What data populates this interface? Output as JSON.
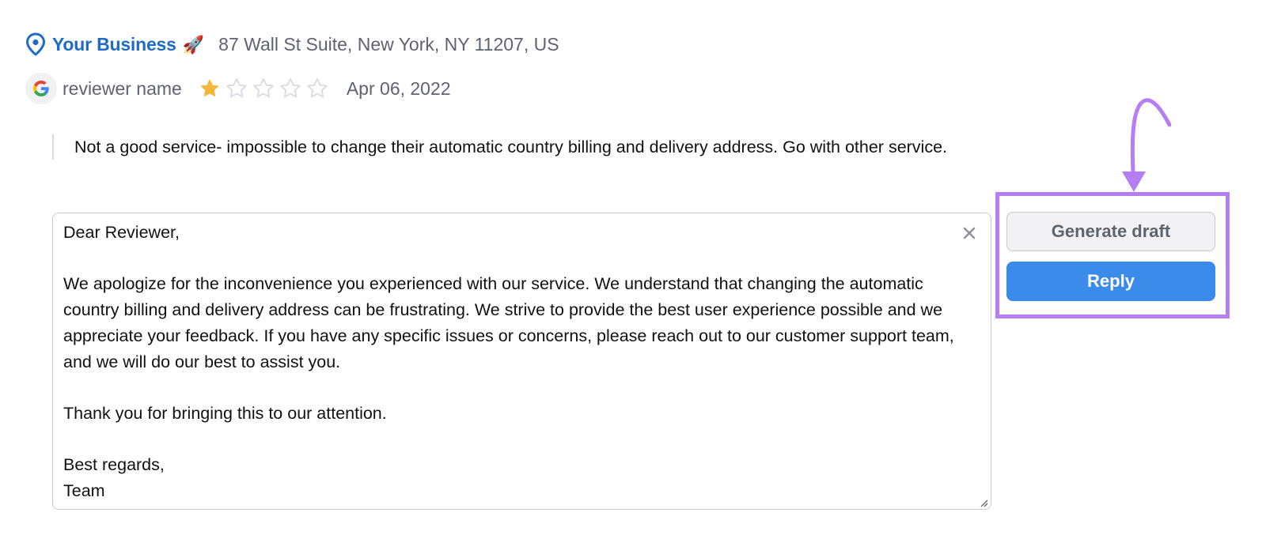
{
  "business": {
    "name": "Your Business",
    "emoji": "🚀",
    "address": "87 Wall St Suite, New York, NY 11207, US"
  },
  "review": {
    "source_icon": "google-icon",
    "reviewer_name": "reviewer name",
    "rating": 1,
    "rating_max": 5,
    "date": "Apr 06, 2022",
    "text": "Not a good service- impossible to change their automatic country billing and delivery address. Go with other service."
  },
  "reply": {
    "value": "Dear Reviewer,\n\nWe apologize for the inconvenience you experienced with our service. We understand that changing the automatic country billing and delivery address can be frustrating. We strive to provide the best user experience possible and we appreciate your feedback. If you have any specific issues or concerns, please reach out to our customer support team, and we will do our best to assist you.\n\nThank you for bringing this to our attention.\n\nBest regards,\nTeam",
    "clear_icon": "close-icon"
  },
  "actions": {
    "generate_draft_label": "Generate draft",
    "reply_label": "Reply"
  },
  "colors": {
    "brand_blue": "#1f6bc8",
    "reply_button": "#3b8beb",
    "star_filled": "#f5b73b",
    "star_empty": "#dcdde3",
    "highlight": "#b57ef5"
  }
}
